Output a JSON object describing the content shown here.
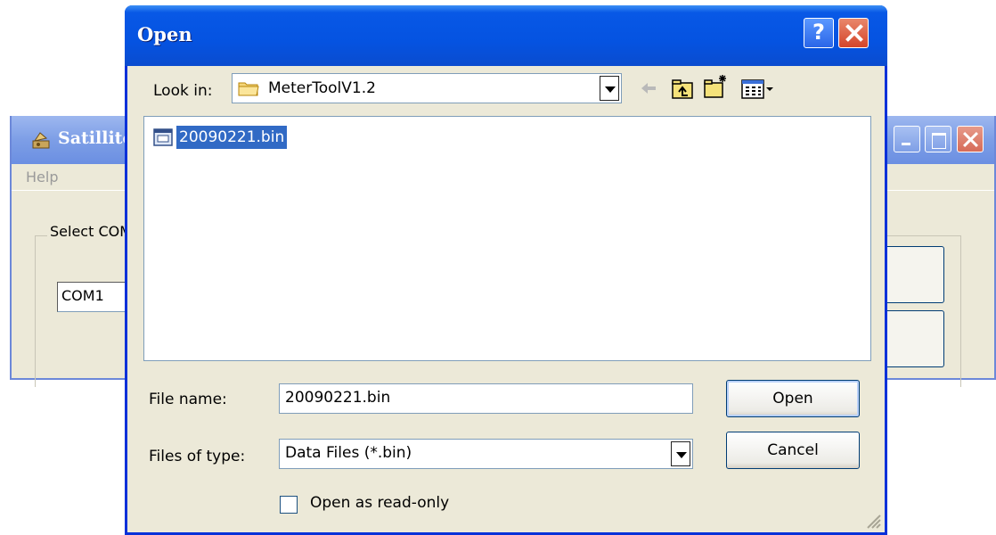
{
  "background_window": {
    "title": "Satillite",
    "menu": {
      "help": "Help"
    },
    "group_label": "Select COM",
    "com_value": "COM1"
  },
  "dialog": {
    "title": "Open",
    "help_button": "?",
    "look_in": {
      "label": "Look in:",
      "value": "MeterToolV1.2"
    },
    "toolbar": {
      "icons": [
        "back-arrow-icon",
        "up-folder-icon",
        "new-folder-icon",
        "view-menu-icon"
      ]
    },
    "files": [
      {
        "name": "20090221.bin",
        "selected": true
      }
    ],
    "file_name": {
      "label": "File name:",
      "value": "20090221.bin"
    },
    "files_of_type": {
      "label": "Files of type:",
      "value": "Data Files (*.bin)"
    },
    "buttons": {
      "open": "Open",
      "cancel": "Cancel"
    },
    "read_only": {
      "label": "Open as read-only",
      "checked": false
    }
  },
  "colors": {
    "title_bar": "#0553e1",
    "dialog_face": "#ece9d8",
    "selection": "#316ac5",
    "background_title_bar": "#7d9ee6"
  }
}
